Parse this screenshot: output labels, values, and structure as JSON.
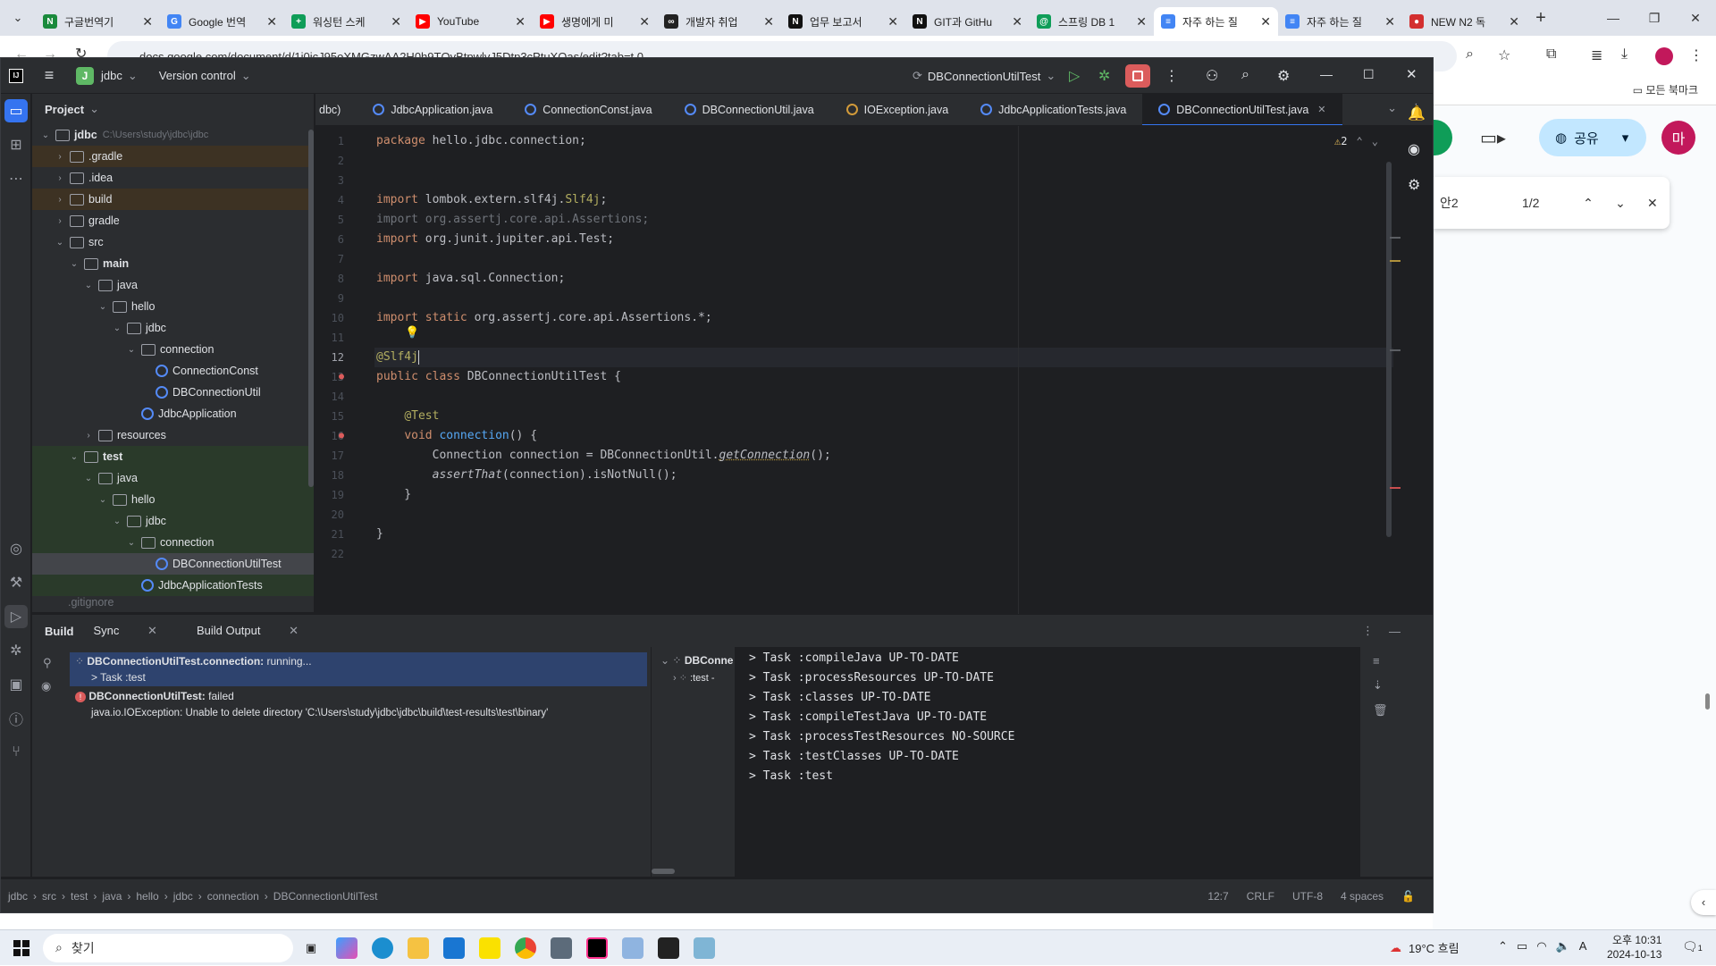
{
  "chrome": {
    "tabs": [
      {
        "label": "구글번역기",
        "color": "#1a8a3c",
        "glyph": "N"
      },
      {
        "label": "Google 번역",
        "color": "#4285f4",
        "glyph": "G"
      },
      {
        "label": "워싱턴 스케",
        "color": "#0f9d58",
        "glyph": "+"
      },
      {
        "label": "YouTube",
        "color": "#ff0000",
        "glyph": "▶"
      },
      {
        "label": "생명에게 미",
        "color": "#ff0000",
        "glyph": "▶"
      },
      {
        "label": "개발자 취업",
        "color": "#222222",
        "glyph": "∞"
      },
      {
        "label": "업무 보고서",
        "color": "#111111",
        "glyph": "N"
      },
      {
        "label": "GIT과 GitHu",
        "color": "#111111",
        "glyph": "N"
      },
      {
        "label": "스프링 DB 1",
        "color": "#0f9d58",
        "glyph": "@"
      },
      {
        "label": "자주 하는 질",
        "color": "#4285f4",
        "glyph": "≡"
      },
      {
        "label": "자주 하는 질",
        "color": "#4285f4",
        "glyph": "≡"
      },
      {
        "label": "NEW N2 독",
        "color": "#d32f2f",
        "glyph": "●"
      }
    ],
    "active_tab_index": 9,
    "url": "docs.google.com/document/d/1i0jcJ95oXMGzwAA2H0h9TQvBtpwlvJ5Dtp3cPtuXQas/edit?tab=t.0",
    "bookmark_folder": "모든 북마크"
  },
  "gdocs": {
    "share_label": "공유",
    "avatar_letter": "마",
    "find_text": "안2",
    "find_count": "1/2"
  },
  "ide": {
    "project_name": "jdbc",
    "project_badge": "J",
    "vcs_label": "Version control",
    "run_config": "DBConnectionUtilTest",
    "project_header": "Project",
    "tree": [
      {
        "label": "jdbc",
        "path": "C:\\Users\\study\\jdbc\\jdbc",
        "depth": 0,
        "open": true,
        "kind": "folder",
        "bold": true
      },
      {
        "label": ".gradle",
        "depth": 1,
        "open": false,
        "kind": "folder",
        "style": "excluded"
      },
      {
        "label": ".idea",
        "depth": 1,
        "open": false,
        "kind": "folder"
      },
      {
        "label": "build",
        "depth": 1,
        "open": false,
        "kind": "folder",
        "style": "excluded"
      },
      {
        "label": "gradle",
        "depth": 1,
        "open": false,
        "kind": "folder"
      },
      {
        "label": "src",
        "depth": 1,
        "open": true,
        "kind": "folder"
      },
      {
        "label": "main",
        "depth": 2,
        "open": true,
        "kind": "folder",
        "bold": true
      },
      {
        "label": "java",
        "depth": 3,
        "open": true,
        "kind": "folder"
      },
      {
        "label": "hello",
        "depth": 4,
        "open": true,
        "kind": "folder"
      },
      {
        "label": "jdbc",
        "depth": 5,
        "open": true,
        "kind": "folder"
      },
      {
        "label": "connection",
        "depth": 6,
        "open": true,
        "kind": "folder"
      },
      {
        "label": "ConnectionConst",
        "depth": 7,
        "kind": "class"
      },
      {
        "label": "DBConnectionUtil",
        "depth": 7,
        "kind": "class"
      },
      {
        "label": "JdbcApplication",
        "depth": 6,
        "kind": "class"
      },
      {
        "label": "resources",
        "depth": 3,
        "open": false,
        "kind": "folder"
      },
      {
        "label": "test",
        "depth": 2,
        "open": true,
        "kind": "folder",
        "bold": true,
        "style": "green"
      },
      {
        "label": "java",
        "depth": 3,
        "open": true,
        "kind": "folder",
        "style": "green"
      },
      {
        "label": "hello",
        "depth": 4,
        "open": true,
        "kind": "folder",
        "style": "green"
      },
      {
        "label": "jdbc",
        "depth": 5,
        "open": true,
        "kind": "folder",
        "style": "green"
      },
      {
        "label": "connection",
        "depth": 6,
        "open": true,
        "kind": "folder",
        "style": "green"
      },
      {
        "label": "DBConnectionUtilTest",
        "depth": 7,
        "kind": "class",
        "style": "selected"
      },
      {
        "label": "JdbcApplicationTests",
        "depth": 6,
        "kind": "class",
        "style": "green"
      }
    ],
    "tree_partial": ".gitignore",
    "editor_tabs": [
      {
        "label": "dbc)",
        "icon": "none"
      },
      {
        "label": "JdbcApplication.java",
        "icon": "class"
      },
      {
        "label": "ConnectionConst.java",
        "icon": "class"
      },
      {
        "label": "DBConnectionUtil.java",
        "icon": "class"
      },
      {
        "label": "IOException.java",
        "icon": "exc"
      },
      {
        "label": "JdbcApplicationTests.java",
        "icon": "class"
      },
      {
        "label": "DBConnectionUtilTest.java",
        "icon": "class",
        "active": true
      }
    ],
    "warnings_count": "2",
    "code_lines": [
      [
        {
          "t": "package ",
          "c": "kw"
        },
        {
          "t": "hello.jdbc.connection;"
        }
      ],
      [],
      [],
      [
        {
          "t": "import ",
          "c": "kw"
        },
        {
          "t": "lombok.extern.slf4j."
        },
        {
          "t": "Slf4j",
          "c": "ann"
        },
        {
          "t": ";"
        }
      ],
      [
        {
          "t": "import org.assertj.core.api.Assertions;",
          "c": "gray"
        }
      ],
      [
        {
          "t": "import ",
          "c": "kw"
        },
        {
          "t": "org.junit.jupiter.api.Test;"
        }
      ],
      [],
      [
        {
          "t": "import ",
          "c": "kw"
        },
        {
          "t": "java.sql.Connection;"
        }
      ],
      [],
      [
        {
          "t": "import static ",
          "c": "kw"
        },
        {
          "t": "org.assertj.core.api.Assertions.*;"
        }
      ],
      [],
      [
        {
          "t": "@Slf4j",
          "c": "ann"
        }
      ],
      [
        {
          "t": "public class ",
          "c": "kw"
        },
        {
          "t": "DBConnectionUtilTest {"
        }
      ],
      [],
      [
        {
          "t": "    "
        },
        {
          "t": "@Test",
          "c": "ann"
        }
      ],
      [
        {
          "t": "    "
        },
        {
          "t": "void ",
          "c": "kw"
        },
        {
          "t": "connection",
          "c": "mth"
        },
        {
          "t": "() {"
        }
      ],
      [
        {
          "t": "        Connection connection = DBConnectionUtil."
        },
        {
          "t": "getConnection",
          "c": "it"
        },
        {
          "t": "();"
        }
      ],
      [
        {
          "t": "        "
        },
        {
          "t": "assertThat",
          "c": "it"
        },
        {
          "t": "(connection).isNotNull();"
        }
      ],
      [
        {
          "t": "    }"
        }
      ],
      [],
      [
        {
          "t": "}"
        }
      ],
      []
    ],
    "current_line": 12,
    "build": {
      "tabs": [
        "Build",
        "Sync",
        "Build Output"
      ],
      "running_title": "DBConnectionUtilTest.connection:",
      "running_status": "running...",
      "running_sub": "> Task :test",
      "failed_title": "DBConnectionUtilTest:",
      "failed_status": "failed",
      "failed_detail": "java.io.IOException: Unable to delete directory 'C:\\Users\\study\\jdbc\\jdbc\\build\\test-results\\test\\binary'",
      "mid_title": "DBConne",
      "mid_sub": ":test -",
      "output": [
        "> Task :compileJava UP-TO-DATE",
        "> Task :processResources UP-TO-DATE",
        "> Task :classes UP-TO-DATE",
        "> Task :compileTestJava UP-TO-DATE",
        "> Task :processTestResources NO-SOURCE",
        "> Task :testClasses UP-TO-DATE",
        "> Task :test"
      ]
    },
    "status": {
      "breadcrumb": [
        "jdbc",
        "src",
        "test",
        "java",
        "hello",
        "jdbc",
        "connection",
        "DBConnectionUtilTest"
      ],
      "position": "12:7",
      "line_sep": "CRLF",
      "encoding": "UTF-8",
      "indent": "4 spaces"
    }
  },
  "taskbar": {
    "search_label": "찾기",
    "weather": "19°C 흐림",
    "time": "오후 10:31",
    "date": "2024-10-13",
    "notif_count": "1"
  }
}
